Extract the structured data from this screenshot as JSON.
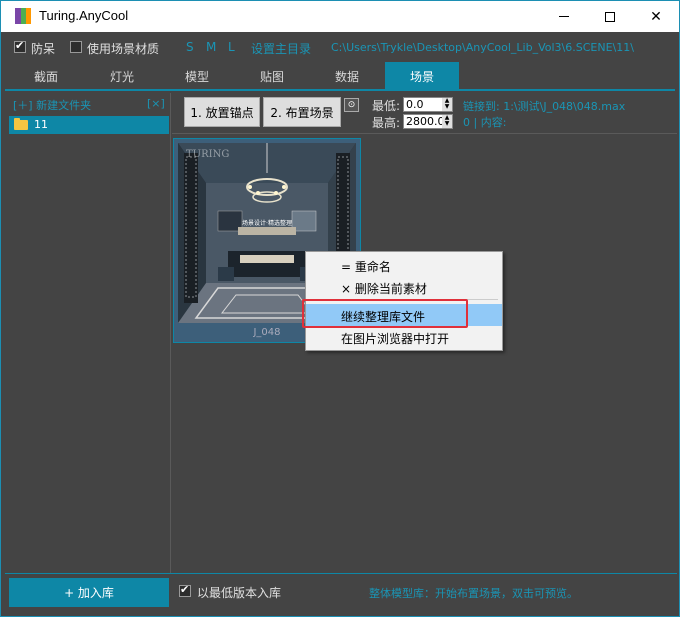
{
  "window": {
    "title": "Turing.AnyCool",
    "min_label": "—",
    "max_label": "☐",
    "close_label": "✕"
  },
  "options": {
    "anti_stupid": {
      "label": "防呆",
      "checked": true
    },
    "use_scene_material": {
      "label": "使用场景材质",
      "checked": false
    },
    "sizes": [
      "S",
      "M",
      "L"
    ],
    "set_main_dir": "设置主目录",
    "path": "C:\\Users\\Trykle\\Desktop\\AnyCool_Lib_Vol3\\6.SCENE\\11\\"
  },
  "tabs": [
    {
      "label": "截面",
      "active": false
    },
    {
      "label": "灯光",
      "active": false
    },
    {
      "label": "模型",
      "active": false
    },
    {
      "label": "贴图",
      "active": false
    },
    {
      "label": "数据",
      "active": false
    },
    {
      "label": "场景",
      "active": true
    }
  ],
  "left_panel": {
    "new_folder": "[＋] 新建文件夹",
    "collapse": "[×]",
    "folders": [
      {
        "label": "11"
      }
    ]
  },
  "toolbar": {
    "place_anchor": "1. 放置锚点",
    "arrange_scene": "2. 布置场景",
    "small_icon": "⊙",
    "min_label": "最低:",
    "min_value": "0.0",
    "max_label": "最高:",
    "max_value": "2800.0",
    "link_to": "链接到: 1:\\测试\\J_048\\048.max",
    "content_info": "0 | 内容:"
  },
  "thumbnail": {
    "caption": "J_048",
    "watermark": "TURING",
    "sign_text": "场景设计·精选整理"
  },
  "context_menu": {
    "items": [
      {
        "label": "= 重命名",
        "highlighted": false
      },
      {
        "label": "× 删除当前素材",
        "highlighted": false
      },
      {
        "label": "继续整理库文件",
        "highlighted": true
      },
      {
        "label": "在图片浏览器中打开",
        "highlighted": false
      }
    ]
  },
  "bottom": {
    "add_to_lib": "+ 加入库",
    "lowest_version": {
      "label": "以最低版本入库",
      "checked": true
    },
    "status": "整体模型库：开始布置场景，双击可预览。"
  },
  "colors": {
    "accent": "#0e87a6",
    "link": "#1a95b5",
    "background": "#444444",
    "highlight_frame": "#e0303a",
    "menu_highlight": "#91c9f7"
  }
}
